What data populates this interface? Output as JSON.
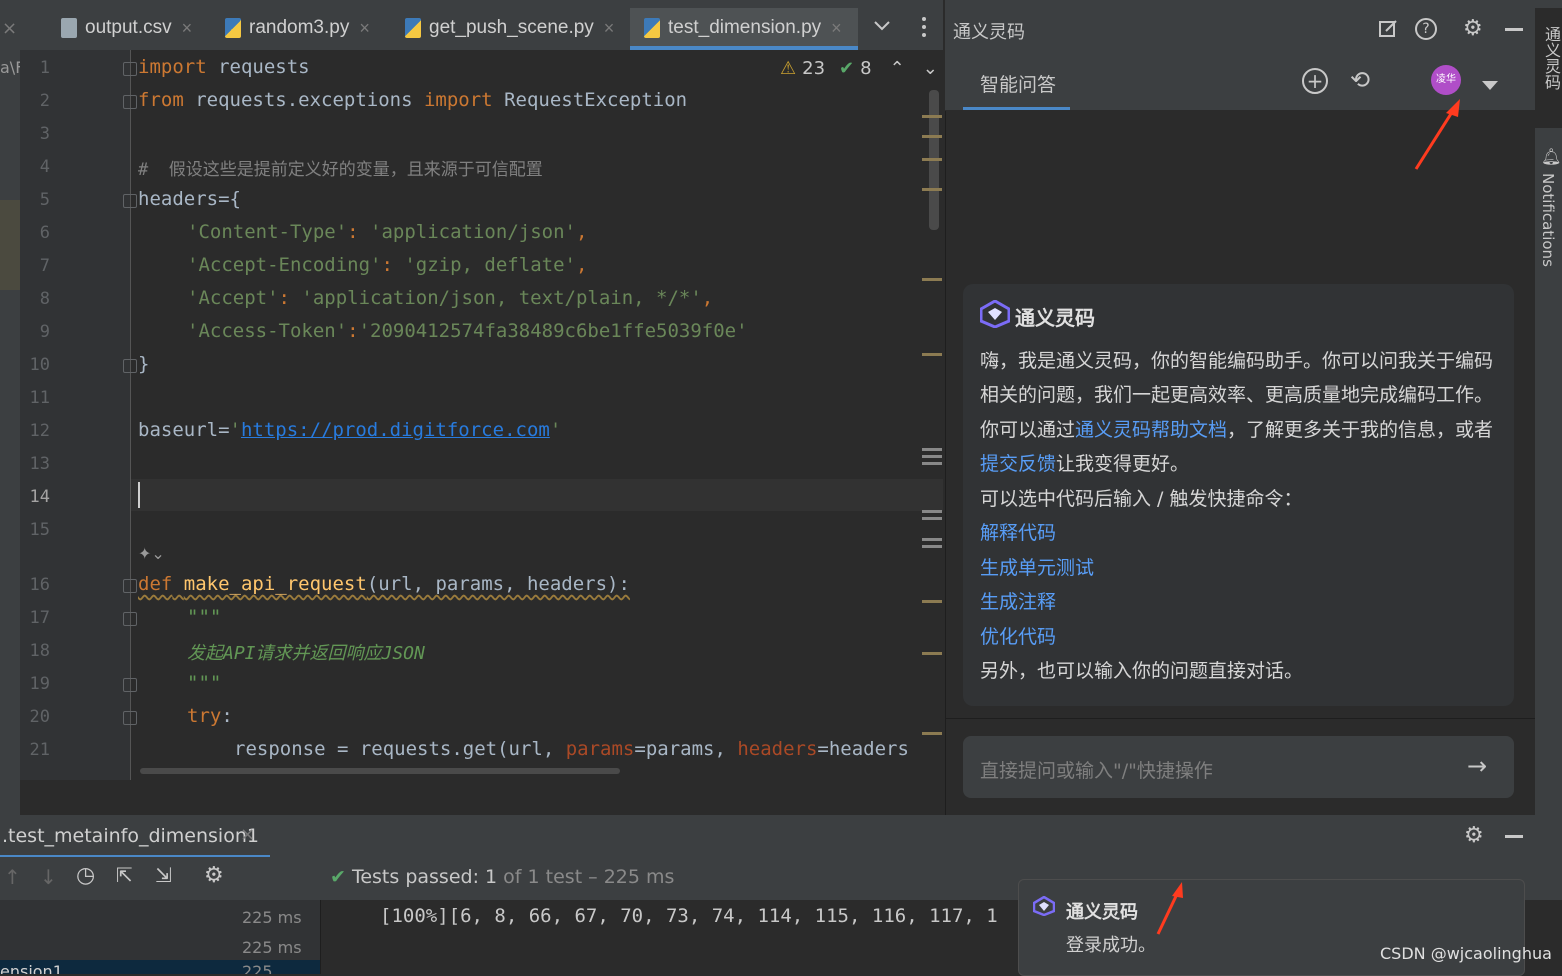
{
  "editor_tabs": [
    {
      "label": "output.csv"
    },
    {
      "label": "random3.py"
    },
    {
      "label": "get_push_scene.py"
    },
    {
      "label": "test_dimension.py"
    }
  ],
  "inspection": {
    "warnings": "23",
    "ok": "8"
  },
  "line_numbers": [
    "1",
    "2",
    "3",
    "4",
    "5",
    "6",
    "7",
    "8",
    "9",
    "10",
    "11",
    "12",
    "13",
    "14",
    "15",
    "16",
    "17",
    "18",
    "19",
    "20",
    "21"
  ],
  "code": {
    "l1_kw": "import",
    "l1_rest": " requests",
    "l2_kw": "from",
    "l2_mod": " requests.exceptions ",
    "l2_kw2": "import",
    "l2_rest": " RequestException",
    "l4": "#  假设这些是提前定义好的变量，且来源于可信配置",
    "l5": "headers={",
    "l6_key": "'Content-Type'",
    "l6_val": "'application/json'",
    "l7_key": "'Accept-Encoding'",
    "l7_val": "'gzip, deflate'",
    "l8_key": "'Accept'",
    "l8_val": "'application/json, text/plain, */*'",
    "l9_key": "'Access-Token'",
    "l9_val": "'2090412574fa38489c6be1ffe5039f0e'",
    "l10": "}",
    "l12_var": "baseurl=",
    "l12_q1": "'",
    "l12_url": "https://prod.digitforce.com",
    "l12_q2": "'",
    "l16_kw": "def",
    "l16_fn": "make_api_request",
    "l16_args": "(url, params, headers):",
    "l17": "\"\"\"",
    "l18": "发起API请求并返回响应JSON",
    "l19": "\"\"\"",
    "l20_kw": "try",
    "l20_rest": ":",
    "l21_a": "response = requests.get(url, ",
    "l21_p1": "params",
    "l21_b": "=params, ",
    "l21_p2": "headers",
    "l21_c": "=headers"
  },
  "ai_panel": {
    "title": "通义灵码",
    "tab": "智能问答",
    "avatar_text": "凌华",
    "welcome_title": "通义灵码",
    "line1": "嗨，我是通义灵码，你的智能编码助手。你可以问我关于编码",
    "line2": "相关的问题，我们一起更高效率、更高质量地完成编码工作。",
    "line3_a": "你可以通过",
    "line3_link": "通义灵码帮助文档",
    "line3_b": "，了解更多关于我的信息，或者",
    "line4_link": "提交反馈",
    "line4_b": "让我变得更好。",
    "line5": "可以选中代码后输入 / 触发快捷命令：",
    "cmd1": "解释代码",
    "cmd2": "生成单元测试",
    "cmd3": "生成注释",
    "cmd4": "优化代码",
    "line_last": "另外，也可以输入你的问题直接对话。",
    "input_placeholder": "直接提问或输入\"/\"快捷操作"
  },
  "side_strip": {
    "tongyi": "通义灵码",
    "notifications": "Notifications"
  },
  "run_panel": {
    "tab_label": ".test_metainfo_dimension1",
    "tests_passed_label": "Tests passed:",
    "tests_passed_count": "1",
    "tests_of": "of 1 test – 225 ms",
    "time1": "225 ms",
    "time2": "225 ms",
    "left_row3": "ension1",
    "left_row3_time": "225",
    "output": "[100%][6, 8, 66, 67, 70, 73, 74, 114, 115, 116, 117, 1"
  },
  "toast": {
    "title": "通义灵码",
    "message": "登录成功。"
  },
  "watermark": "CSDN @wjcaolinghua",
  "colors": {
    "accent": "#4a88c7",
    "link": "#589df6",
    "arrow": "#ff3b1f",
    "ok": "#59a869"
  }
}
